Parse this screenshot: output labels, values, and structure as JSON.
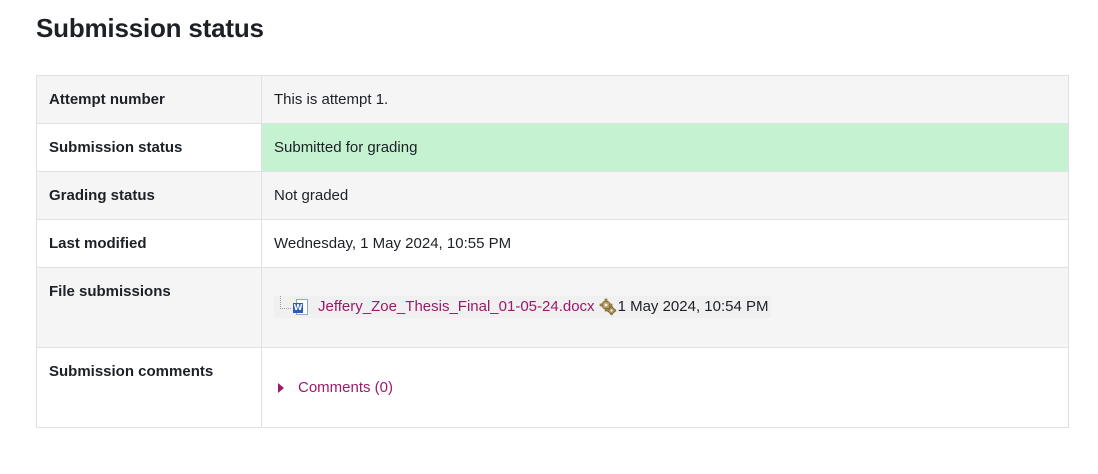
{
  "page": {
    "title": "Submission status"
  },
  "rows": [
    {
      "label": "Attempt number",
      "value": "This is attempt 1."
    },
    {
      "label": "Submission status",
      "value": "Submitted for grading"
    },
    {
      "label": "Grading status",
      "value": "Not graded"
    },
    {
      "label": "Last modified",
      "value": "Wednesday, 1 May 2024, 10:55 PM"
    },
    {
      "label": "File submissions"
    },
    {
      "label": "Submission comments"
    }
  ],
  "file": {
    "name": "Jeffery_Zoe_Thesis_Final_01-05-24.docx",
    "date": "1 May 2024, 10:54 PM",
    "icon": "word-document-icon",
    "badge_letter": "W"
  },
  "comments": {
    "label": "Comments (0)"
  },
  "colors": {
    "accent_link": "#9b1a6a",
    "submitted_bg": "#c5f2d1",
    "row_alt_bg": "#f5f5f5",
    "border": "#dee2e6"
  }
}
